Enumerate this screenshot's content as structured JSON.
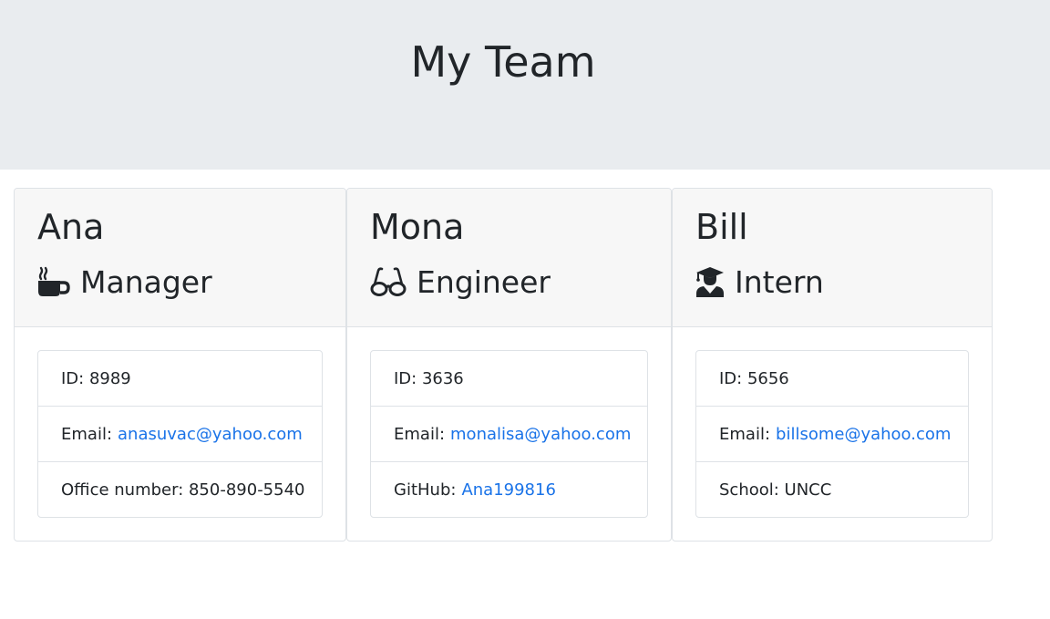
{
  "header": {
    "title": "My Team"
  },
  "colors": {
    "jumbotron_bg": "#e9ecef",
    "card_header_bg": "#f7f7f7",
    "link": "#1a73e8"
  },
  "cards": [
    {
      "name": "Ana",
      "role": "Manager",
      "role_icon": "coffee-mug-icon",
      "id_label": "ID: 8989",
      "email_label": "Email:",
      "email": "anasuvac@yahoo.com",
      "extra_label": "Office number: 850-890-5540"
    },
    {
      "name": "Mona",
      "role": "Engineer",
      "role_icon": "glasses-icon",
      "id_label": "ID: 3636",
      "email_label": "Email:",
      "email": "monalisa@yahoo.com",
      "extra_prefix": "GitHub:",
      "extra_link": "Ana199816"
    },
    {
      "name": "Bill",
      "role": "Intern",
      "role_icon": "graduate-icon",
      "id_label": "ID: 5656",
      "email_label": "Email:",
      "email": "billsome@yahoo.com",
      "extra_label": "School: UNCC"
    }
  ]
}
